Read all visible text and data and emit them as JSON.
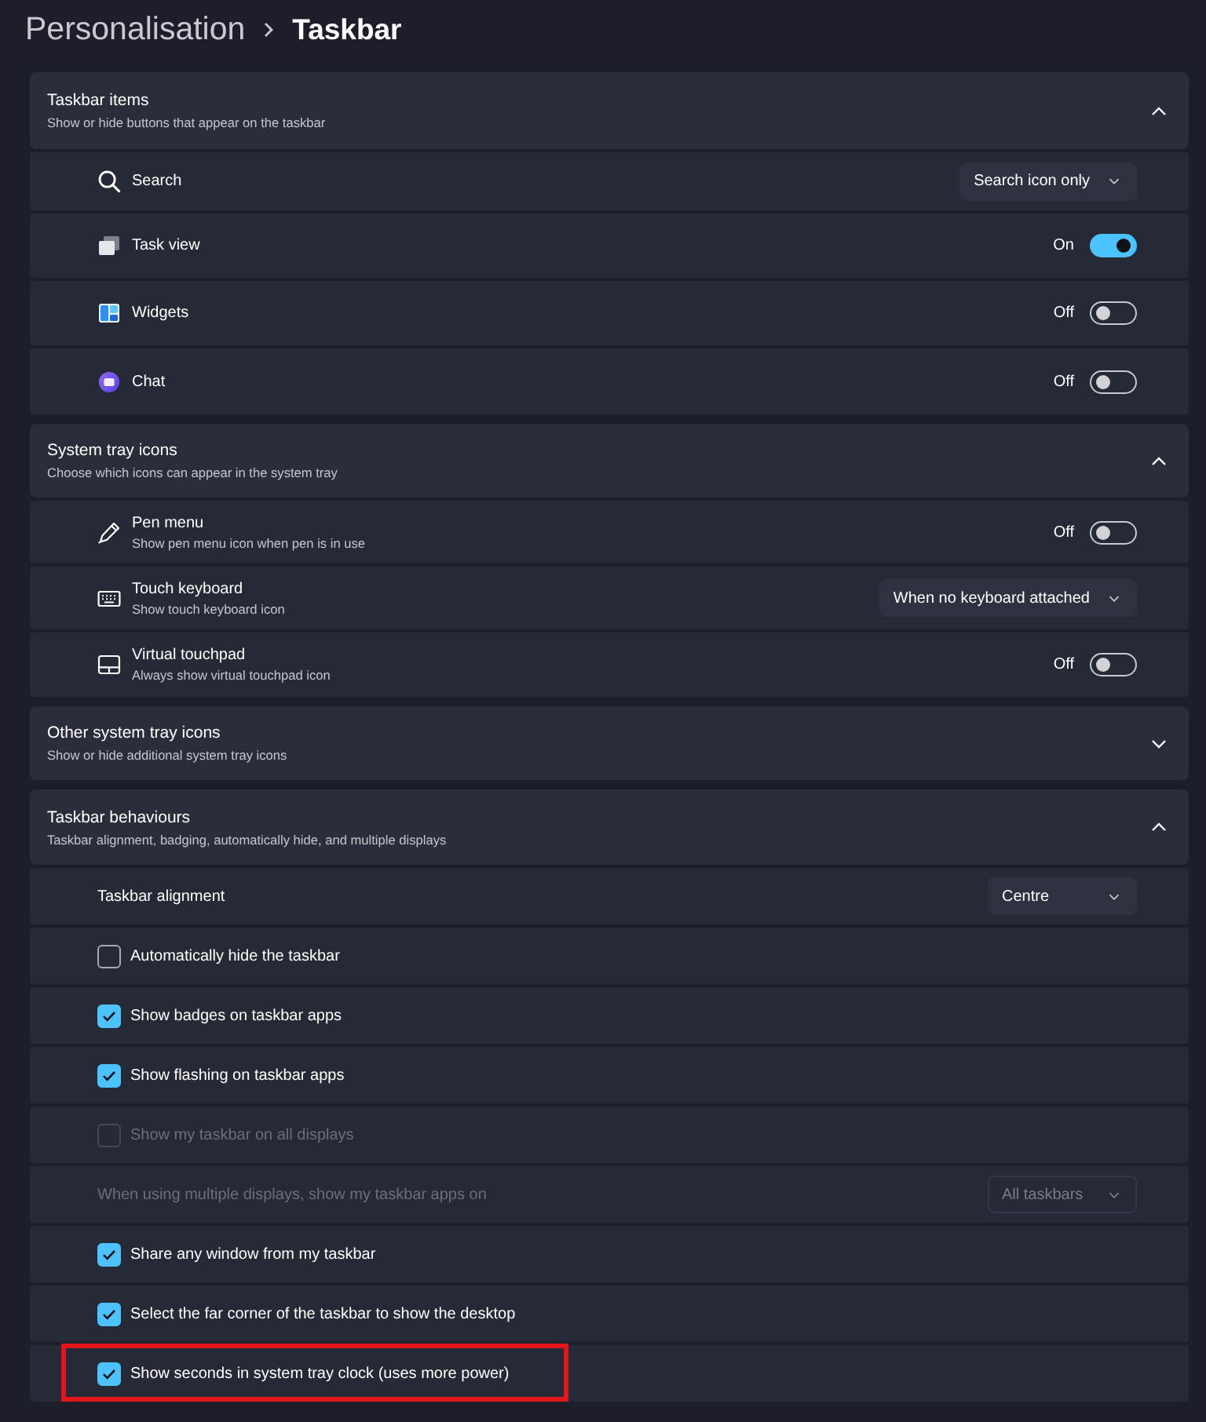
{
  "breadcrumb": [
    {
      "label": "Personalisation",
      "current": false
    },
    {
      "label": "Taskbar",
      "current": true
    }
  ],
  "sections": [
    {
      "title": "Taskbar items",
      "subtitle": "Show or hide buttons that appear on the taskbar",
      "expanded": true,
      "rows": [
        {
          "kind": "dropdown",
          "label": "Search",
          "value": "Search icon only"
        },
        {
          "kind": "toggle",
          "label": "Task view",
          "state_label": "On",
          "on": true
        },
        {
          "kind": "toggle",
          "label": "Widgets",
          "state_label": "Off",
          "on": false
        },
        {
          "kind": "toggle",
          "label": "Chat",
          "state_label": "Off",
          "on": false
        }
      ]
    },
    {
      "title": "System tray icons",
      "subtitle": "Choose which icons can appear in the system tray",
      "expanded": true,
      "rows": [
        {
          "kind": "toggle",
          "label": "Pen menu",
          "description": "Show pen menu icon when pen is in use",
          "state_label": "Off",
          "on": false
        },
        {
          "kind": "dropdown",
          "label": "Touch keyboard",
          "description": "Show touch keyboard icon",
          "value": "When no keyboard attached"
        },
        {
          "kind": "toggle",
          "label": "Virtual touchpad",
          "description": "Always show virtual touchpad icon",
          "state_label": "Off",
          "on": false
        }
      ]
    },
    {
      "title": "Other system tray icons",
      "subtitle": "Show or hide additional system tray icons",
      "expanded": false
    },
    {
      "title": "Taskbar behaviours",
      "subtitle": "Taskbar alignment, badging, automatically hide, and multiple displays",
      "expanded": true,
      "rows": [
        {
          "kind": "dropdown",
          "label": "Taskbar alignment",
          "value": "Centre",
          "disabled": false,
          "highlighted": false
        },
        {
          "kind": "checkbox",
          "label": "Automatically hide the taskbar",
          "checked": false,
          "disabled": false,
          "highlighted": false
        },
        {
          "kind": "checkbox",
          "label": "Show badges on taskbar apps",
          "checked": true,
          "disabled": false,
          "highlighted": false
        },
        {
          "kind": "checkbox",
          "label": "Show flashing on taskbar apps",
          "checked": true,
          "disabled": false,
          "highlighted": false
        },
        {
          "kind": "checkbox",
          "label": "Show my taskbar on all displays",
          "checked": false,
          "disabled": true,
          "highlighted": false
        },
        {
          "kind": "dropdown",
          "label": "When using multiple displays, show my taskbar apps on",
          "value": "All taskbars",
          "disabled": true,
          "highlighted": false
        },
        {
          "kind": "checkbox",
          "label": "Share any window from my taskbar",
          "checked": true,
          "disabled": false,
          "highlighted": false
        },
        {
          "kind": "checkbox",
          "label": "Select the far corner of the taskbar to show the desktop",
          "checked": true,
          "disabled": false,
          "highlighted": false
        },
        {
          "kind": "checkbox",
          "label": "Show seconds in system tray clock (uses more power)",
          "checked": true,
          "disabled": false,
          "highlighted": true
        }
      ]
    }
  ]
}
